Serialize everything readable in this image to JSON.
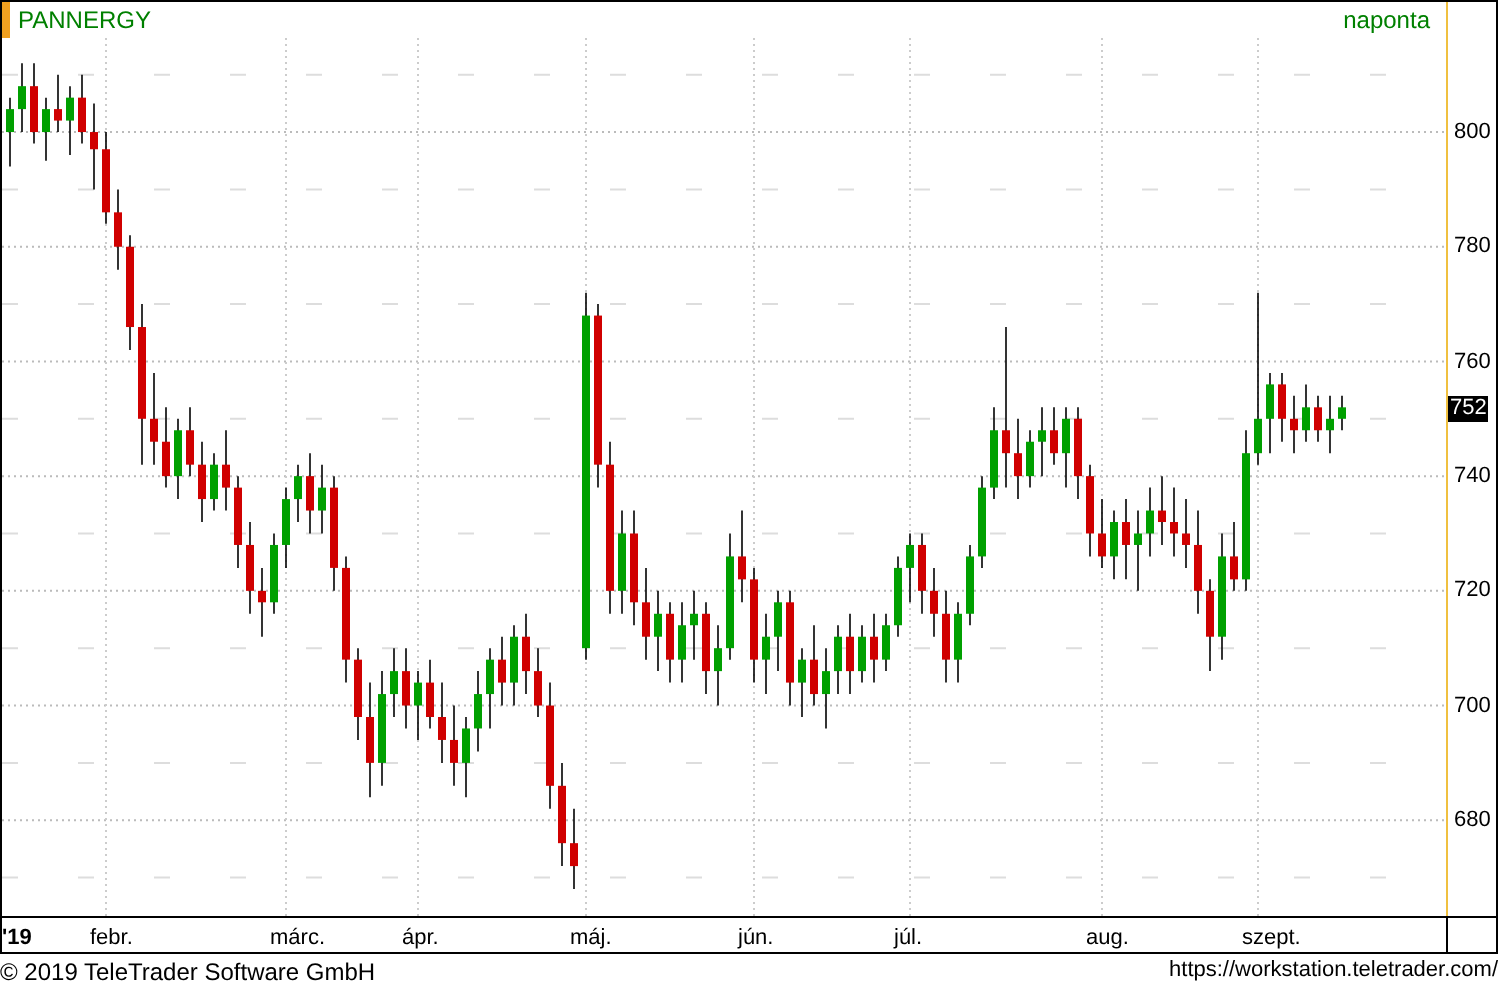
{
  "chart": {
    "symbol": "PANNERGY",
    "period": "naponta",
    "last_price": "752",
    "year_label": "'19",
    "chart_data": {
      "type": "candlestick",
      "ylim": [
        663.3,
        816.4
      ],
      "grid": true,
      "yticks": [
        800,
        780,
        760,
        740,
        720,
        700,
        680
      ],
      "categories": [
        null,
        null,
        null,
        null,
        null,
        null,
        null,
        null,
        "febr.",
        null,
        null,
        null,
        null,
        null,
        null,
        null,
        null,
        null,
        null,
        null,
        null,
        null,
        null,
        "márc.",
        null,
        null,
        null,
        null,
        null,
        null,
        null,
        null,
        null,
        null,
        "ápr.",
        null,
        null,
        null,
        null,
        null,
        null,
        null,
        null,
        null,
        null,
        null,
        null,
        null,
        "máj.",
        null,
        null,
        null,
        null,
        null,
        null,
        null,
        null,
        null,
        null,
        null,
        null,
        null,
        "jún.",
        null,
        null,
        null,
        null,
        null,
        null,
        null,
        null,
        null,
        null,
        null,
        null,
        "júl.",
        null,
        null,
        null,
        null,
        null,
        null,
        null,
        null,
        null,
        null,
        null,
        null,
        null,
        null,
        null,
        "aug.",
        null,
        null,
        null,
        null,
        null,
        null,
        null,
        null,
        null,
        null,
        null,
        null,
        "szept.",
        null,
        null,
        null,
        null,
        null,
        null,
        null
      ],
      "ohlc": [
        [
          800,
          806,
          794,
          804
        ],
        [
          804,
          812,
          800,
          808
        ],
        [
          808,
          812,
          798,
          800
        ],
        [
          800,
          806,
          795,
          804
        ],
        [
          804,
          810,
          800,
          802
        ],
        [
          802,
          808,
          796,
          806
        ],
        [
          806,
          810,
          798,
          800
        ],
        [
          800,
          805,
          790,
          797
        ],
        [
          797,
          800,
          784,
          786
        ],
        [
          786,
          790,
          776,
          780
        ],
        [
          780,
          782,
          762,
          766
        ],
        [
          766,
          770,
          742,
          750
        ],
        [
          750,
          758,
          742,
          746
        ],
        [
          746,
          752,
          738,
          740
        ],
        [
          740,
          750,
          736,
          748
        ],
        [
          748,
          752,
          740,
          742
        ],
        [
          742,
          746,
          732,
          736
        ],
        [
          736,
          744,
          734,
          742
        ],
        [
          742,
          748,
          734,
          738
        ],
        [
          738,
          740,
          724,
          728
        ],
        [
          728,
          732,
          716,
          720
        ],
        [
          720,
          724,
          712,
          718
        ],
        [
          718,
          730,
          716,
          728
        ],
        [
          728,
          738,
          724,
          736
        ],
        [
          736,
          742,
          732,
          740
        ],
        [
          740,
          744,
          730,
          734
        ],
        [
          734,
          742,
          730,
          738
        ],
        [
          738,
          740,
          720,
          724
        ],
        [
          724,
          726,
          704,
          708
        ],
        [
          708,
          710,
          694,
          698
        ],
        [
          698,
          704,
          684,
          690
        ],
        [
          690,
          706,
          686,
          702
        ],
        [
          702,
          710,
          698,
          706
        ],
        [
          706,
          710,
          696,
          700
        ],
        [
          700,
          706,
          694,
          704
        ],
        [
          704,
          708,
          696,
          698
        ],
        [
          698,
          704,
          690,
          694
        ],
        [
          694,
          700,
          686,
          690
        ],
        [
          690,
          698,
          684,
          696
        ],
        [
          696,
          706,
          692,
          702
        ],
        [
          702,
          710,
          696,
          708
        ],
        [
          708,
          712,
          700,
          704
        ],
        [
          704,
          714,
          700,
          712
        ],
        [
          712,
          716,
          702,
          706
        ],
        [
          706,
          710,
          698,
          700
        ],
        [
          700,
          704,
          682,
          686
        ],
        [
          686,
          690,
          672,
          676
        ],
        [
          676,
          682,
          668,
          672
        ],
        [
          710,
          772,
          708,
          768
        ],
        [
          768,
          770,
          738,
          742
        ],
        [
          742,
          746,
          716,
          720
        ],
        [
          720,
          734,
          716,
          730
        ],
        [
          730,
          734,
          714,
          718
        ],
        [
          718,
          724,
          708,
          712
        ],
        [
          712,
          720,
          706,
          716
        ],
        [
          716,
          718,
          704,
          708
        ],
        [
          708,
          718,
          704,
          714
        ],
        [
          714,
          720,
          708,
          716
        ],
        [
          716,
          718,
          702,
          706
        ],
        [
          706,
          714,
          700,
          710
        ],
        [
          710,
          730,
          708,
          726
        ],
        [
          726,
          734,
          718,
          722
        ],
        [
          722,
          724,
          704,
          708
        ],
        [
          708,
          716,
          702,
          712
        ],
        [
          712,
          720,
          706,
          718
        ],
        [
          718,
          720,
          700,
          704
        ],
        [
          704,
          710,
          698,
          708
        ],
        [
          708,
          714,
          700,
          702
        ],
        [
          702,
          710,
          696,
          706
        ],
        [
          706,
          714,
          702,
          712
        ],
        [
          712,
          716,
          702,
          706
        ],
        [
          706,
          714,
          704,
          712
        ],
        [
          712,
          716,
          704,
          708
        ],
        [
          708,
          716,
          706,
          714
        ],
        [
          714,
          726,
          712,
          724
        ],
        [
          724,
          730,
          718,
          728
        ],
        [
          728,
          730,
          716,
          720
        ],
        [
          720,
          724,
          712,
          716
        ],
        [
          716,
          720,
          704,
          708
        ],
        [
          708,
          718,
          704,
          716
        ],
        [
          716,
          728,
          714,
          726
        ],
        [
          726,
          740,
          724,
          738
        ],
        [
          738,
          752,
          736,
          748
        ],
        [
          748,
          766,
          738,
          744
        ],
        [
          744,
          750,
          736,
          740
        ],
        [
          740,
          748,
          738,
          746
        ],
        [
          746,
          752,
          740,
          748
        ],
        [
          748,
          752,
          742,
          744
        ],
        [
          744,
          752,
          738,
          750
        ],
        [
          750,
          752,
          736,
          740
        ],
        [
          740,
          742,
          726,
          730
        ],
        [
          730,
          736,
          724,
          726
        ],
        [
          726,
          734,
          722,
          732
        ],
        [
          732,
          736,
          722,
          728
        ],
        [
          728,
          734,
          720,
          730
        ],
        [
          730,
          738,
          726,
          734
        ],
        [
          734,
          740,
          728,
          732
        ],
        [
          732,
          738,
          726,
          730
        ],
        [
          730,
          736,
          724,
          728
        ],
        [
          728,
          734,
          716,
          720
        ],
        [
          720,
          722,
          706,
          712
        ],
        [
          712,
          730,
          708,
          726
        ],
        [
          726,
          732,
          720,
          722
        ],
        [
          722,
          748,
          720,
          744
        ],
        [
          744,
          772,
          742,
          750
        ],
        [
          750,
          758,
          744,
          756
        ],
        [
          756,
          758,
          746,
          750
        ],
        [
          750,
          754,
          744,
          748
        ],
        [
          748,
          756,
          746,
          752
        ],
        [
          752,
          754,
          746,
          748
        ],
        [
          748,
          754,
          744,
          750
        ],
        [
          750,
          754,
          748,
          752
        ]
      ]
    }
  },
  "footer": {
    "copyright": "© 2019 TeleTrader Software GmbH",
    "url": "https://workstation.teletrader.com/"
  }
}
